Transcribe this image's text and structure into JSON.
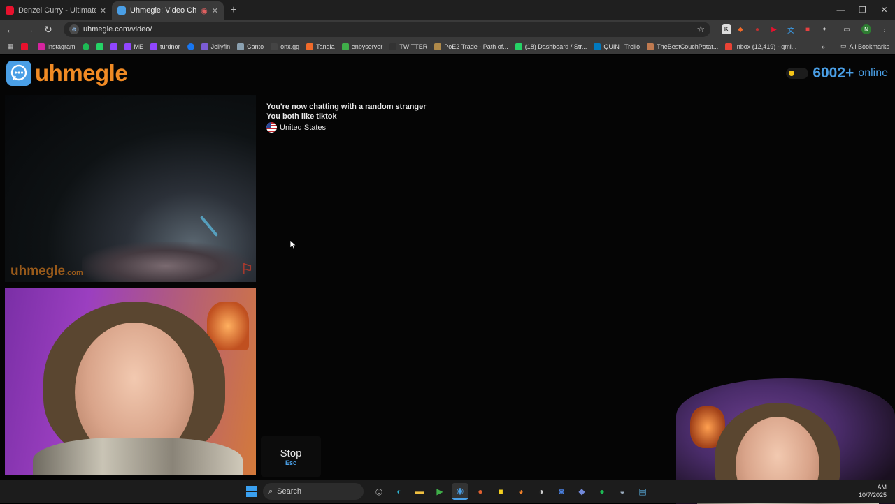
{
  "browser": {
    "tabs": [
      {
        "title": "Denzel Curry - Ultimate (BADB...",
        "favicon_color": "#e8112d"
      },
      {
        "title": "Uhmegle: Video Chat | Onl...",
        "favicon_color": "#4a9fe6"
      }
    ],
    "new_tab_label": "+",
    "address": "uhmegle.com/video/",
    "bookmarks": [
      {
        "label": "",
        "color": "#e8112d"
      },
      {
        "label": "Instagram",
        "color": "#d6249f"
      },
      {
        "label": "",
        "color": "#1db954"
      },
      {
        "label": "",
        "color": "#25d366"
      },
      {
        "label": "",
        "color": "#9146ff"
      },
      {
        "label": "ME",
        "color": "#9146ff"
      },
      {
        "label": "turdnor",
        "color": "#9146ff"
      },
      {
        "label": "",
        "color": "#1877f2"
      },
      {
        "label": "Jellyfin",
        "color": "#7b5cd6"
      },
      {
        "label": "Canto",
        "color": "#8aa0b0"
      },
      {
        "label": "onx.gg",
        "color": "#444444"
      },
      {
        "label": "Tangia",
        "color": "#f06a2a"
      },
      {
        "label": "enbyserver",
        "color": "#3fae49"
      },
      {
        "label": "TWITTER",
        "color": "#333333"
      },
      {
        "label": "PoE2 Trade - Path of...",
        "color": "#b08a4a"
      },
      {
        "label": "(18) Dashboard / Str...",
        "color": "#25d366"
      },
      {
        "label": "QUIN | Trello",
        "color": "#0079bf"
      },
      {
        "label": "TheBestCouchPotat...",
        "color": "#c07a50"
      },
      {
        "label": "Inbox (12,419) - qmi...",
        "color": "#ea4335"
      }
    ],
    "all_bookmarks_label": "All Bookmarks"
  },
  "site": {
    "logo_text": "uhmegle",
    "online_count": "6002+",
    "online_label": "online",
    "watermark": "uhmegle",
    "watermark_suffix": ".com",
    "accent_color": "#4a9fe6",
    "brand_color": "#f08a24"
  },
  "chat": {
    "status_line": "You're now chatting with a random stranger",
    "interest_line": "You both like tiktok",
    "country": "United States"
  },
  "controls": {
    "stop_label": "Stop",
    "stop_key": "Esc"
  },
  "taskbar": {
    "search_label": "Search",
    "time": "AM",
    "date": "10/7/2025"
  }
}
